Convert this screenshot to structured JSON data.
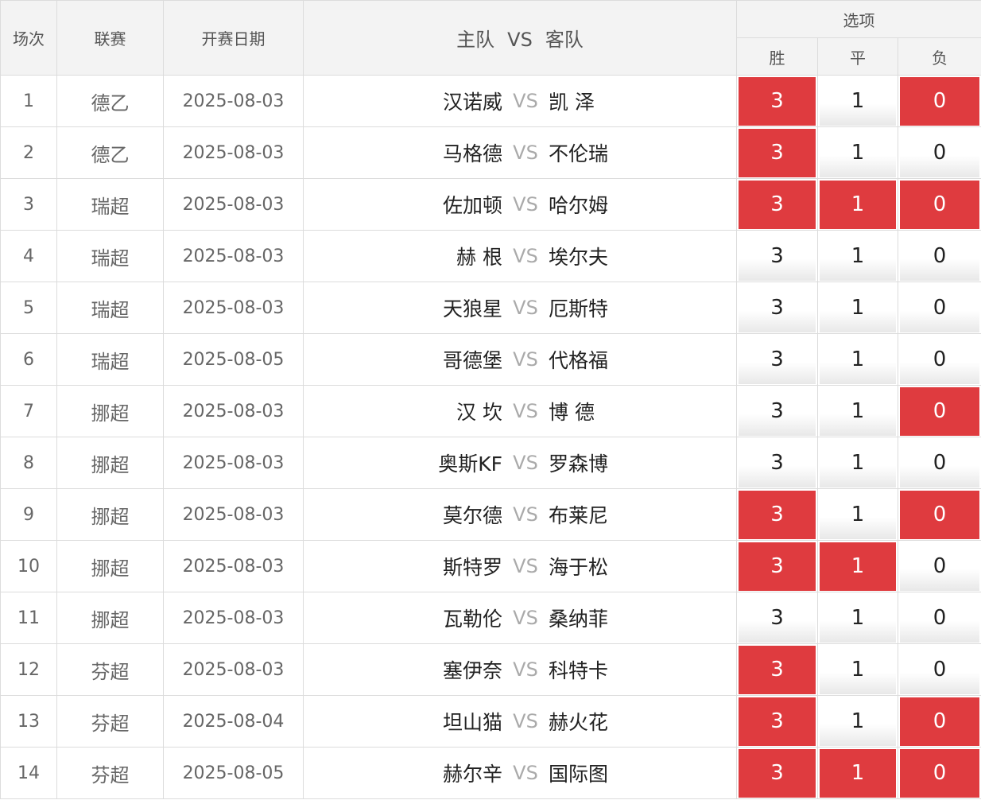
{
  "header": {
    "col_index": "场次",
    "col_league": "联赛",
    "col_date": "开赛日期",
    "col_home": "主队",
    "col_vs": "VS",
    "col_away": "客队",
    "col_options": "选项",
    "opt_win": "胜",
    "opt_draw": "平",
    "opt_lose": "负"
  },
  "colors": {
    "selected": "#df3b3f",
    "header_bg": "#f3f3f3"
  },
  "vs_text": "VS",
  "rows": [
    {
      "idx": "1",
      "league": "德乙",
      "date": "2025-08-03",
      "home": "汉诺威",
      "away": "凯 泽",
      "win": "3",
      "draw": "1",
      "lose": "0",
      "sel_win": true,
      "sel_draw": false,
      "sel_lose": true
    },
    {
      "idx": "2",
      "league": "德乙",
      "date": "2025-08-03",
      "home": "马格德",
      "away": "不伦瑞",
      "win": "3",
      "draw": "1",
      "lose": "0",
      "sel_win": true,
      "sel_draw": false,
      "sel_lose": false
    },
    {
      "idx": "3",
      "league": "瑞超",
      "date": "2025-08-03",
      "home": "佐加顿",
      "away": "哈尔姆",
      "win": "3",
      "draw": "1",
      "lose": "0",
      "sel_win": true,
      "sel_draw": true,
      "sel_lose": true
    },
    {
      "idx": "4",
      "league": "瑞超",
      "date": "2025-08-03",
      "home": "赫 根",
      "away": "埃尔夫",
      "win": "3",
      "draw": "1",
      "lose": "0",
      "sel_win": false,
      "sel_draw": false,
      "sel_lose": false
    },
    {
      "idx": "5",
      "league": "瑞超",
      "date": "2025-08-03",
      "home": "天狼星",
      "away": "厄斯特",
      "win": "3",
      "draw": "1",
      "lose": "0",
      "sel_win": false,
      "sel_draw": false,
      "sel_lose": false
    },
    {
      "idx": "6",
      "league": "瑞超",
      "date": "2025-08-05",
      "home": "哥德堡",
      "away": "代格福",
      "win": "3",
      "draw": "1",
      "lose": "0",
      "sel_win": false,
      "sel_draw": false,
      "sel_lose": false
    },
    {
      "idx": "7",
      "league": "挪超",
      "date": "2025-08-03",
      "home": "汉 坎",
      "away": "博 德",
      "win": "3",
      "draw": "1",
      "lose": "0",
      "sel_win": false,
      "sel_draw": false,
      "sel_lose": true
    },
    {
      "idx": "8",
      "league": "挪超",
      "date": "2025-08-03",
      "home": "奥斯KF",
      "away": "罗森博",
      "win": "3",
      "draw": "1",
      "lose": "0",
      "sel_win": false,
      "sel_draw": false,
      "sel_lose": false
    },
    {
      "idx": "9",
      "league": "挪超",
      "date": "2025-08-03",
      "home": "莫尔德",
      "away": "布莱尼",
      "win": "3",
      "draw": "1",
      "lose": "0",
      "sel_win": true,
      "sel_draw": false,
      "sel_lose": true
    },
    {
      "idx": "10",
      "league": "挪超",
      "date": "2025-08-03",
      "home": "斯特罗",
      "away": "海于松",
      "win": "3",
      "draw": "1",
      "lose": "0",
      "sel_win": true,
      "sel_draw": true,
      "sel_lose": false
    },
    {
      "idx": "11",
      "league": "挪超",
      "date": "2025-08-03",
      "home": "瓦勒伦",
      "away": "桑纳菲",
      "win": "3",
      "draw": "1",
      "lose": "0",
      "sel_win": false,
      "sel_draw": false,
      "sel_lose": false
    },
    {
      "idx": "12",
      "league": "芬超",
      "date": "2025-08-03",
      "home": "塞伊奈",
      "away": "科特卡",
      "win": "3",
      "draw": "1",
      "lose": "0",
      "sel_win": true,
      "sel_draw": false,
      "sel_lose": false
    },
    {
      "idx": "13",
      "league": "芬超",
      "date": "2025-08-04",
      "home": "坦山猫",
      "away": "赫火花",
      "win": "3",
      "draw": "1",
      "lose": "0",
      "sel_win": true,
      "sel_draw": false,
      "sel_lose": true
    },
    {
      "idx": "14",
      "league": "芬超",
      "date": "2025-08-05",
      "home": "赫尔辛",
      "away": "国际图",
      "win": "3",
      "draw": "1",
      "lose": "0",
      "sel_win": true,
      "sel_draw": true,
      "sel_lose": true
    }
  ]
}
